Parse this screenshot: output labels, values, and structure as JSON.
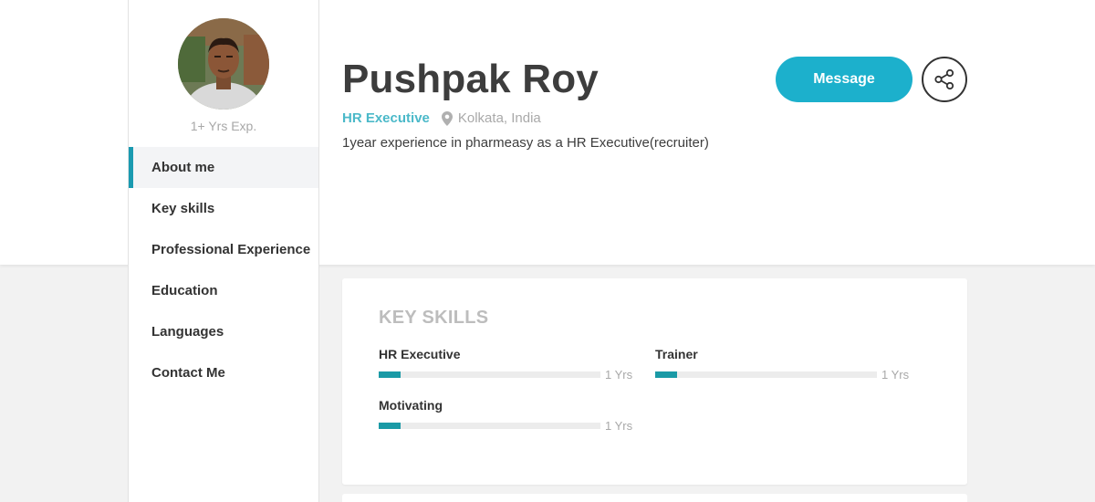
{
  "profile": {
    "name": "Pushpak Roy",
    "role": "HR Executive",
    "location": "Kolkata, India",
    "bio": "1year experience in pharmeasy as a HR Executive(recruiter)",
    "experience": "1+ Yrs Exp."
  },
  "sidebar": {
    "items": [
      {
        "label": "About me",
        "active": true
      },
      {
        "label": "Key skills"
      },
      {
        "label": "Professional Experience"
      },
      {
        "label": "Education"
      },
      {
        "label": "Languages"
      },
      {
        "label": "Contact Me"
      }
    ]
  },
  "actions": {
    "message_label": "Message",
    "share_icon": "share-icon"
  },
  "key_skills": {
    "title": "KEY SKILLS",
    "skills": [
      {
        "name": "HR Executive",
        "years": "1 Yrs",
        "level": 0.1
      },
      {
        "name": "Trainer",
        "years": "1 Yrs",
        "level": 0.1
      },
      {
        "name": "Motivating",
        "years": "1 Yrs",
        "level": 0.1
      }
    ]
  },
  "colors": {
    "accent": "#1cb0cc",
    "bar_fill": "#1a9aa6",
    "role_text": "#4bb9c9"
  }
}
